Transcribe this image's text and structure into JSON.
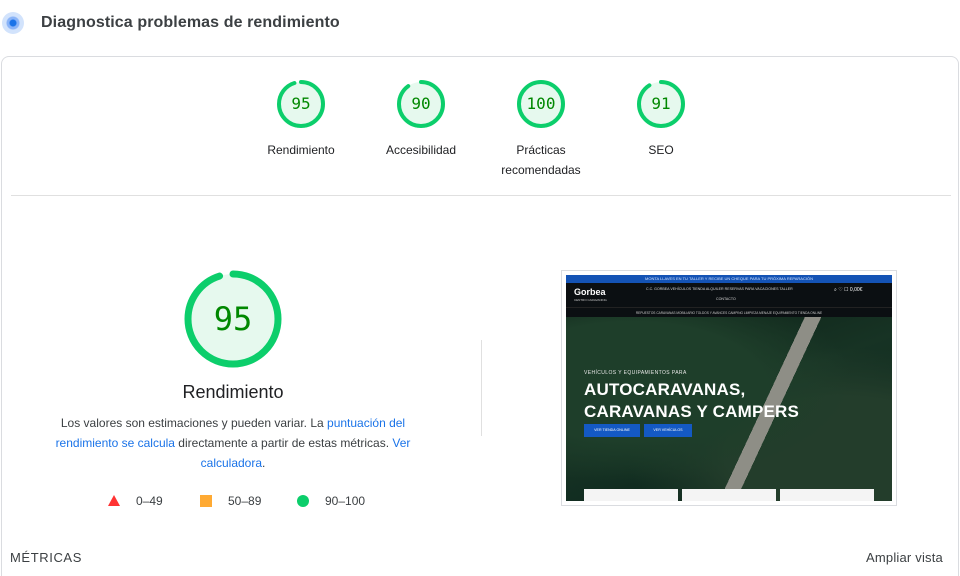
{
  "header": {
    "title": "Diagnostica problemas de rendimiento"
  },
  "colors": {
    "pass": "#0cce6b",
    "pass_fill": "#e6f9ee",
    "pass_text": "#008800",
    "average": "#ffaa33",
    "fail": "#ff3333",
    "link": "#1a73e8"
  },
  "scores": [
    {
      "label": "Rendimiento",
      "value": 95
    },
    {
      "label": "Accesibilidad",
      "value": 90
    },
    {
      "label": "Prácticas recomendadas",
      "value": 100
    },
    {
      "label": "SEO",
      "value": 91
    }
  ],
  "performance": {
    "value": 95,
    "label": "Rendimiento",
    "desc_prefix": "Los valores son estimaciones y pueden variar. La ",
    "desc_link1": "puntuación del rendimiento se calcula",
    "desc_middle": " directamente a partir de estas métricas. ",
    "desc_link2": "Ver calculadora",
    "desc_suffix": "."
  },
  "legend": [
    {
      "icon": "triangle-icon",
      "range": "0–49"
    },
    {
      "icon": "square-icon",
      "range": "50–89"
    },
    {
      "icon": "circle-icon",
      "range": "90–100"
    }
  ],
  "screenshot": {
    "topbar": "MONTA LLAVES EN TU TALLER Y RECIBE UN CHEQUE PARA TU PRÓXIMA REPARACIÓN",
    "brand": "Gorbea",
    "brand_sub": "CENTRO CARAVANING",
    "nav_links": "C.C. GORBEA   VEHÍCULOS   TIENDA   ALQUILER   RESERVAS PARA VACACIONES   TALLER",
    "nav_links2": "CONTACTO",
    "nav_icons": "⌕ ♡ ☐ 0,00€",
    "subnav": "REPUESTOS CARAVANAS   MOBILIARIO   TOLDOS Y AVANCES   CAMPING LIMPIEZA   MENAJE   EQUIPAMIENTO   TIENDA ONLINE",
    "kicker": "VEHÍCULOS Y EQUIPAMIENTOS PARA",
    "headline_line1": "AUTOCARAVANAS,",
    "headline_line2": "CARAVANAS Y CAMPERS",
    "button1": "VER TIENDA ONLINE",
    "button2": "VER VEHÍCULOS"
  },
  "footer": {
    "metrics_label": "MÉTRICAS",
    "expand_label": "Ampliar vista"
  }
}
